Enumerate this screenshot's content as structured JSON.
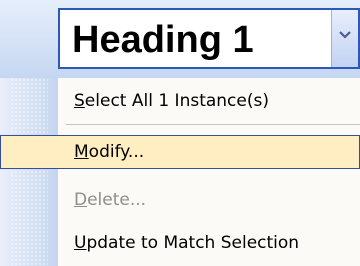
{
  "style_dropdown": {
    "value": "Heading 1",
    "arrow_icon": "chevron-down-icon"
  },
  "menu": {
    "items": [
      {
        "mnemonic": "S",
        "rest": "elect All 1 Instance(s)",
        "state": "normal"
      },
      {
        "mnemonic": "M",
        "rest": "odify...",
        "state": "highlighted"
      },
      {
        "mnemonic": "D",
        "rest": "elete...",
        "state": "disabled"
      },
      {
        "mnemonic": "U",
        "rest": "pdate to Match Selection",
        "state": "normal"
      }
    ]
  },
  "colors": {
    "highlight_fill": "#ffeec2",
    "highlight_border": "#344f9a",
    "dropdown_border": "#2d57b8",
    "disabled_text": "#8d8d8d"
  }
}
